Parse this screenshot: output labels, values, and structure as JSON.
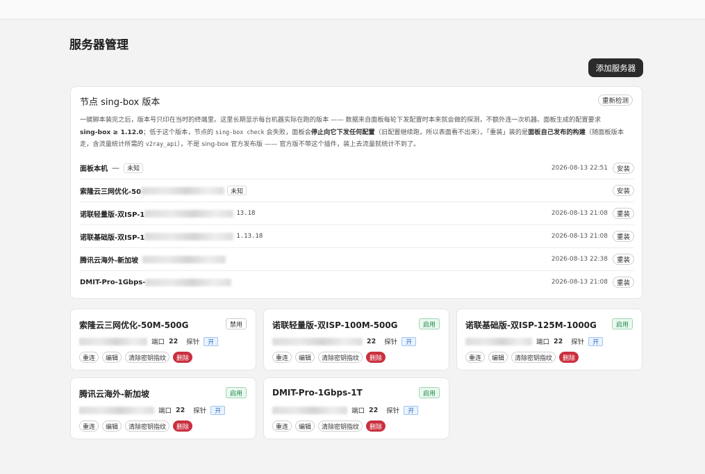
{
  "page": {
    "title": "服务器管理",
    "add_button": "添加服务器"
  },
  "version_card": {
    "title": "节点 sing-box 版本",
    "recheck_button": "重新检测",
    "desc": {
      "p1": "一键脚本装完之后，版本号只印在当时的终端里。这里长期显示每台机器实际在跑的版本 —— 数据来自面板每轮下发配置时本来就会做的探测，不额外连一次机器。面板生成的配置要求",
      "p2_bold": "sing-box ≥ 1.12.0",
      "p3": "；低于这个版本，节点的",
      "p4_code": "sing-box check",
      "p5": "会失败，面板会",
      "p6_bold": "停止向它下发任何配置",
      "p7": "（旧配置继续跑，所以表面看不出来）。「重装」装的是",
      "p8_bold": "面板自己发布的构建",
      "p9": "（随面板版本走，含流量统计所需的",
      "p10_code": "v2ray_api",
      "p11": "），不是 sing-box 官方发布版 —— 官方版不带这个插件，装上去流量就统计不到了。"
    },
    "rows": [
      {
        "name": "面板本机",
        "dash": "—",
        "status": "未知",
        "version": "",
        "time": "2026-08-13 22:51",
        "action": "安装"
      },
      {
        "name": "索隆云三网优化-50",
        "dash": "",
        "status": "未知",
        "version": "",
        "time": "",
        "action": "安装"
      },
      {
        "name": "诺联轻量版-双ISP-1",
        "dash": "",
        "status": "",
        "version": "13.18",
        "time": "2026-08-13 21:08",
        "action": "重装"
      },
      {
        "name": "诺联基础版-双ISP-1",
        "dash": "",
        "status": "",
        "version": "1.13.18",
        "time": "2026-08-13 21:08",
        "action": "重装"
      },
      {
        "name": "腾讯云海外-新加坡",
        "dash": "",
        "status": "",
        "version": "",
        "time": "2026-08-13 22:38",
        "action": "重装"
      },
      {
        "name": "DMIT-Pro-1Gbps-",
        "dash": "",
        "status": "",
        "version": "",
        "time": "2026-08-13 21:08",
        "action": "重装"
      }
    ]
  },
  "servers": [
    {
      "name": "索隆云三网优化-50M-500G",
      "status": "禁用",
      "enabled": false,
      "port_label": "端口",
      "port": "22",
      "probe_label": "探针",
      "probe": "开",
      "actions": [
        "重连",
        "编辑",
        "清除密钥指纹",
        "删除"
      ]
    },
    {
      "name": "诺联轻量版-双ISP-100M-500G",
      "status": "启用",
      "enabled": true,
      "port_label": "",
      "port": "22",
      "probe_label": "探针",
      "probe": "开",
      "actions": [
        "重连",
        "编辑",
        "清除密钥指纹",
        "删除"
      ]
    },
    {
      "name": "诺联基础版-双ISP-125M-1000G",
      "status": "启用",
      "enabled": true,
      "port_label": "端口",
      "port": "22",
      "probe_label": "探针",
      "probe": "开",
      "actions": [
        "重连",
        "编辑",
        "清除密钥指纹",
        "删除"
      ]
    },
    {
      "name": "腾讯云海外-新加坡",
      "status": "启用",
      "enabled": true,
      "port_label": "端口",
      "port": "22",
      "probe_label": "探针",
      "probe": "开",
      "actions": [
        "重连",
        "编辑",
        "清除密钥指纹",
        "删除"
      ]
    },
    {
      "name": "DMIT-Pro-1Gbps-1T",
      "status": "启用",
      "enabled": true,
      "port_label": "端口",
      "port": "22",
      "probe_label": "探针",
      "probe": "开",
      "actions": [
        "重连",
        "编辑",
        "清除密钥指纹",
        "删除"
      ]
    }
  ],
  "colors": {
    "accent_dark": "#2b2b2b",
    "enabled_green": "#1e8a4a",
    "delete_red": "#c9303f",
    "probe_blue": "#2f6fc0"
  }
}
